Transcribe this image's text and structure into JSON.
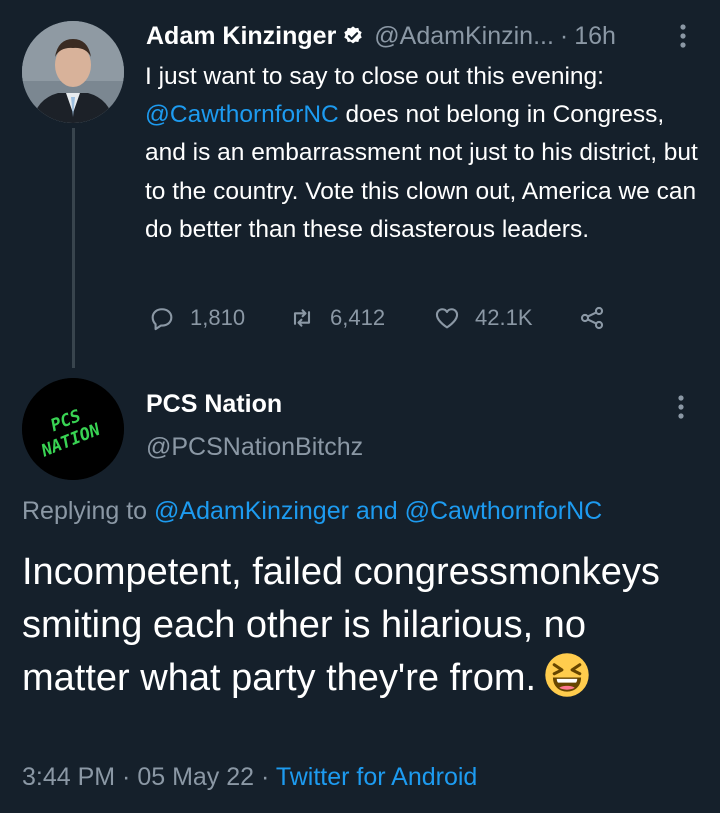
{
  "tweet1": {
    "author_name": "Adam Kinzinger",
    "handle": "@AdamKinzin...",
    "separator": "·",
    "time": "16h",
    "text_before": "I just want to say to close out this evening: ",
    "mention": "@CawthornforNC",
    "text_after": " does not belong in Congress, and is an embarrassment not just to his district, but to the country.  Vote this clown out, America we can do better than these disasterous leaders.",
    "replies": "1,810",
    "retweets": "6,412",
    "likes": "42.1K"
  },
  "tweet2": {
    "author_name": "PCS Nation",
    "handle": "@PCSNationBitchz",
    "avatar_text": "PCS NATION",
    "reply_prefix": "Replying to ",
    "reply_mention1": "@AdamKinzinger",
    "reply_and": " and ",
    "reply_mention2": "@CawthornforNC",
    "text": "Incompetent, failed congressmonkeys smiting each other is hilarious, no matter what party they're from.",
    "time": "3:44 PM",
    "sep1": " · ",
    "date": "05 May 22",
    "sep2": " · ",
    "source": "Twitter for Android"
  },
  "colors": {
    "background": "#15202b",
    "link": "#1d9bf0",
    "muted": "#8b98a5",
    "avatar2_text": "#39d353"
  },
  "icons": [
    "verified-badge-icon",
    "more-options-icon",
    "reply-icon",
    "retweet-icon",
    "like-icon",
    "share-icon",
    "laughing-emoji-icon"
  ]
}
